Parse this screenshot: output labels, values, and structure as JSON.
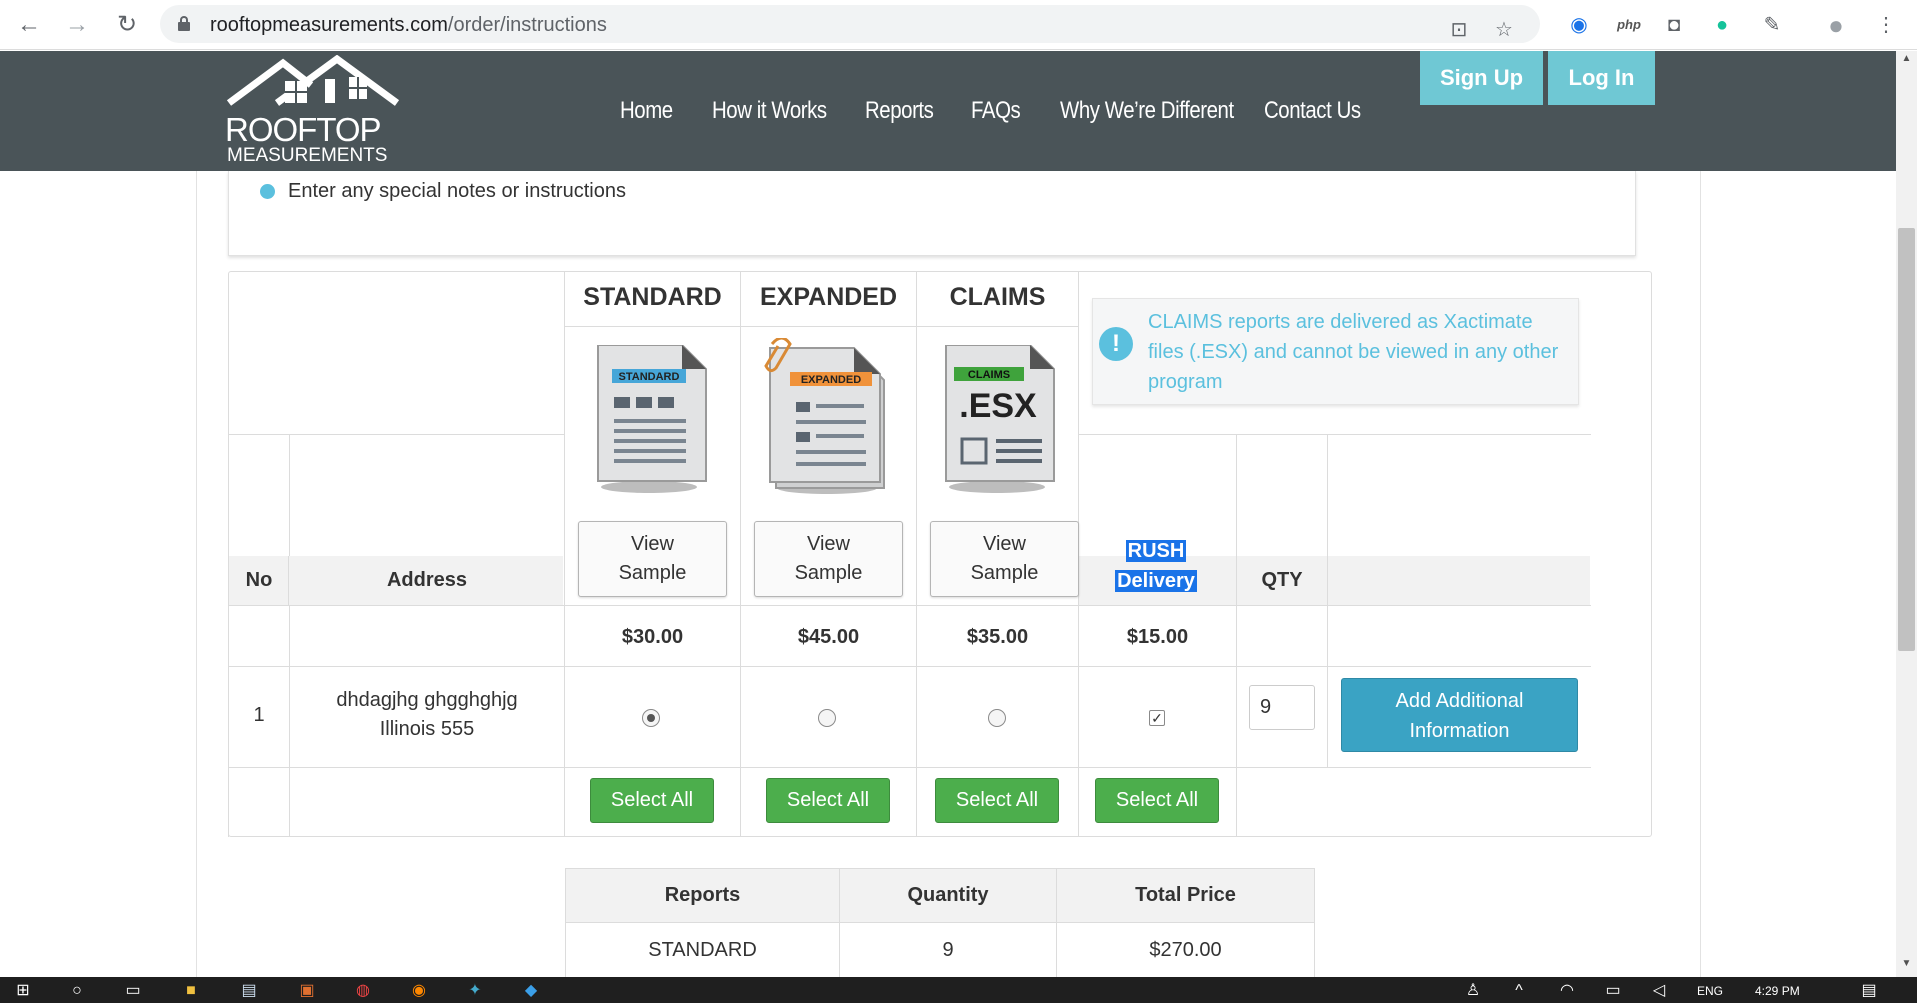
{
  "browser": {
    "url_domain": "rooftopmeasurements.com",
    "url_path": "/order/instructions",
    "ext_php": "php"
  },
  "header": {
    "logo_line1": "ROOFTOP",
    "logo_line2": "MEASUREMENTS",
    "nav": [
      "Home",
      "How it Works",
      "Reports",
      "FAQs",
      "Why We’re Different",
      "Contact Us"
    ],
    "signup": "Sign Up",
    "login": "Log In"
  },
  "notes": {
    "text": "Enter any special notes or instructions"
  },
  "order_table": {
    "col_standard": "STANDARD",
    "col_expanded": "EXPANDED",
    "col_claims": "CLAIMS",
    "badge_standard": "STANDARD",
    "badge_expanded": "EXPANDED",
    "badge_claims": "CLAIMS",
    "esx_label": ".ESX",
    "view_sample_line1": "View",
    "view_sample_line2": "Sample",
    "claims_note": "CLAIMS reports are delivered as Xactimate files (.ESX) and cannot be viewed in any other program",
    "col_no": "No",
    "col_address": "Address",
    "rush_line1": "RUSH",
    "rush_line2": "Delivery",
    "col_qty": "QTY",
    "price_standard": "$30.00",
    "price_expanded": "$45.00",
    "price_claims": "$35.00",
    "price_rush": "$15.00",
    "rows": [
      {
        "no": "1",
        "address_line1": "dhdagjhg ghgghghjg",
        "address_line2": "Illinois 555",
        "selected_report": "STANDARD",
        "rush": true,
        "qty": "9"
      }
    ],
    "add_info_line1": "Add Additional",
    "add_info_line2": "Information",
    "select_all": "Select All"
  },
  "summary": {
    "headers": [
      "Reports",
      "Quantity",
      "Total Price"
    ],
    "rows": [
      {
        "report": "STANDARD",
        "quantity": "9",
        "total": "$270.00"
      }
    ]
  },
  "taskbar": {
    "lang": "ENG",
    "time": "4:29 PM"
  },
  "colors": {
    "header_bg": "#4a5458",
    "accent_teal": "#6fc8d4",
    "select_green": "#4cae4c",
    "add_blue": "#3aa3c4",
    "info_blue": "#5bc0de"
  }
}
